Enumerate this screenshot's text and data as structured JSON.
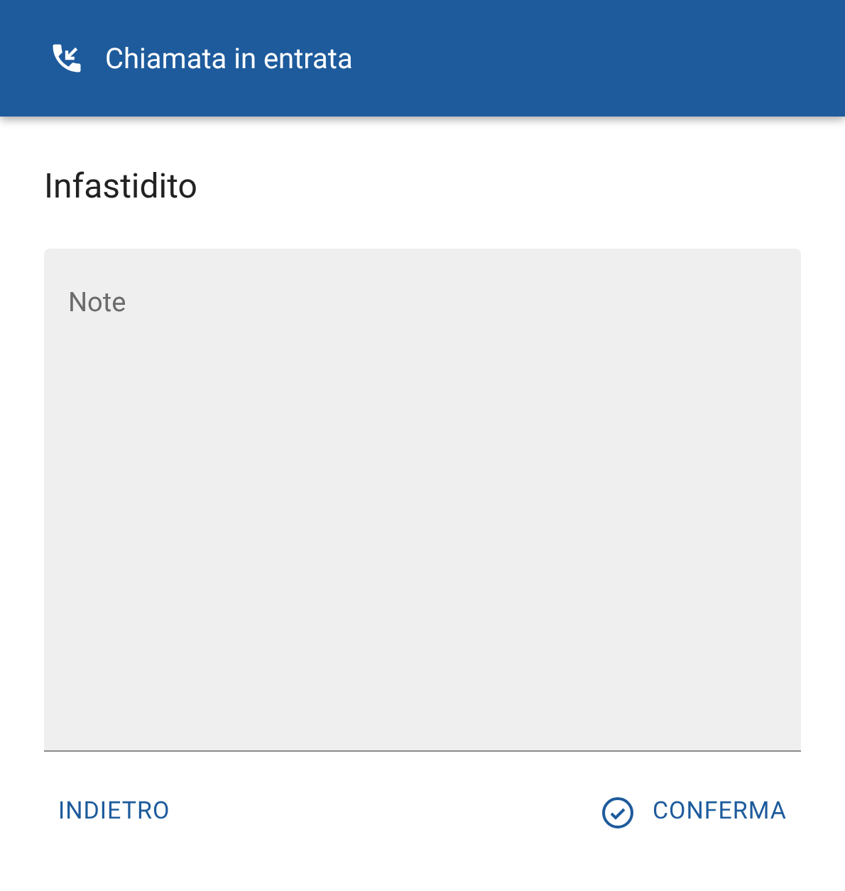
{
  "header": {
    "title": "Chiamata in entrata"
  },
  "heading": "Infastidito",
  "notes": {
    "placeholder": "Note"
  },
  "buttons": [
    {
      "kind": "back",
      "label": "INDIETRO"
    },
    {
      "kind": "confirm",
      "label": "CONFERMA"
    }
  ]
}
